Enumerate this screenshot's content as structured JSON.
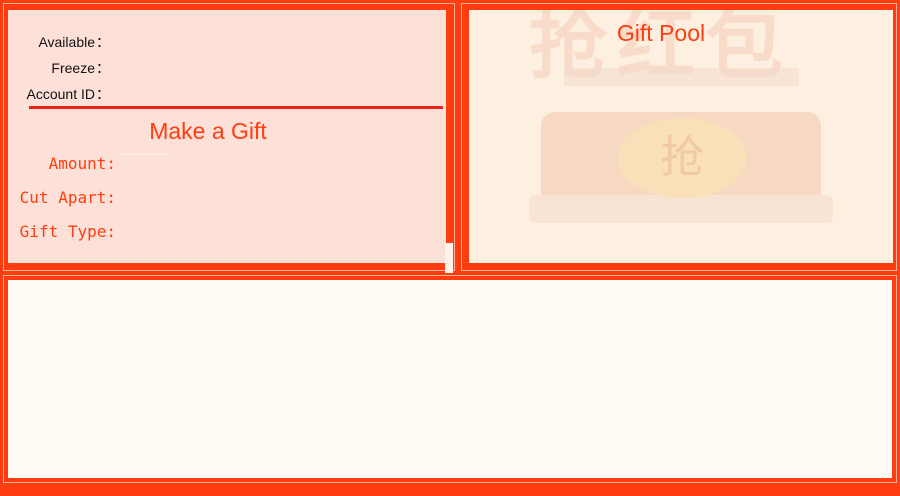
{
  "account": {
    "available_label": "Available",
    "freeze_label": "Freeze",
    "account_id_label": "Account ID",
    "colon": "："
  },
  "make_gift": {
    "title": "Make a Gift",
    "amount_label": "Amount:",
    "cut_apart_label": "Cut Apart:",
    "gift_type_label": "Gift Type:"
  },
  "gift_pool": {
    "title": "Gift Pool",
    "watermark_top_text": "抢红包",
    "watermark_coin_text": "抢"
  },
  "colors": {
    "frame": "#ff3d10",
    "accent": "#ff3d10",
    "divider": "#e8241a",
    "left_panel_bg": "#fde0d8",
    "right_panel_bg": "#fdf0e0",
    "bottom_panel_bg": "#fffaf3"
  }
}
